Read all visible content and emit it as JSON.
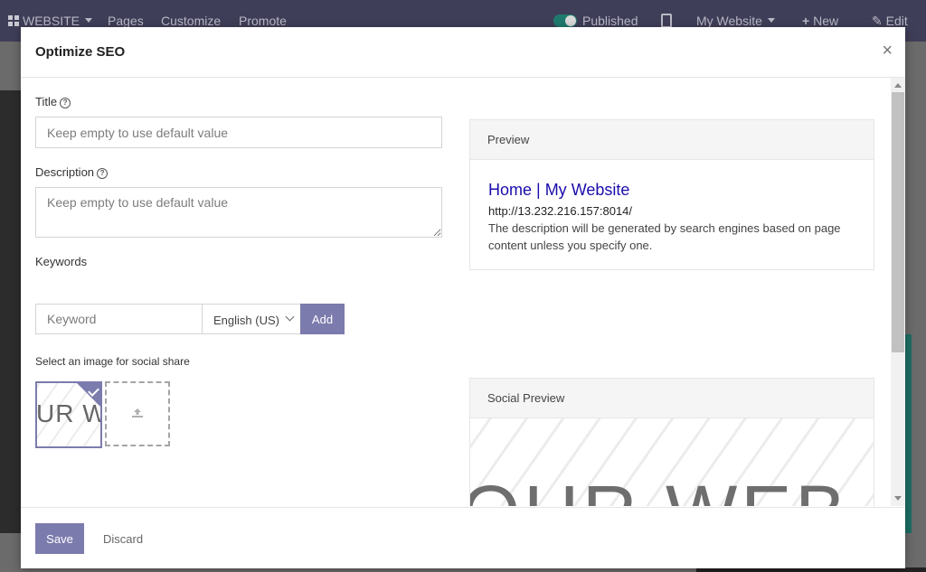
{
  "topbar": {
    "website_label": "WEBSITE",
    "pages": "Pages",
    "customize": "Customize",
    "promote": "Promote",
    "published": "Published",
    "site_name": "My Website",
    "new": "New",
    "edit": "Edit"
  },
  "modal": {
    "title": "Optimize SEO",
    "close": "×",
    "title_label": "Title",
    "title_placeholder": "Keep empty to use default value",
    "description_label": "Description",
    "description_placeholder": "Keep empty to use default value",
    "keywords_label": "Keywords",
    "keyword_placeholder": "Keyword",
    "language": "English (US)",
    "add_button": "Add",
    "social_image_label": "Select an image for social share",
    "thumbnail_text": "UR W",
    "preview": {
      "heading": "Preview",
      "title": "Home | My Website",
      "url": "http://13.232.216.157:8014/",
      "description": "The description will be generated by search engines based on page content unless you specify one."
    },
    "social_preview": {
      "heading": "Social Preview",
      "image_text": "OUR WEB"
    },
    "footer": {
      "save": "Save",
      "discard": "Discard"
    }
  },
  "colors": {
    "primary": "#7c7bad",
    "topbar": "#3f3e58",
    "link": "#1a0dab"
  }
}
